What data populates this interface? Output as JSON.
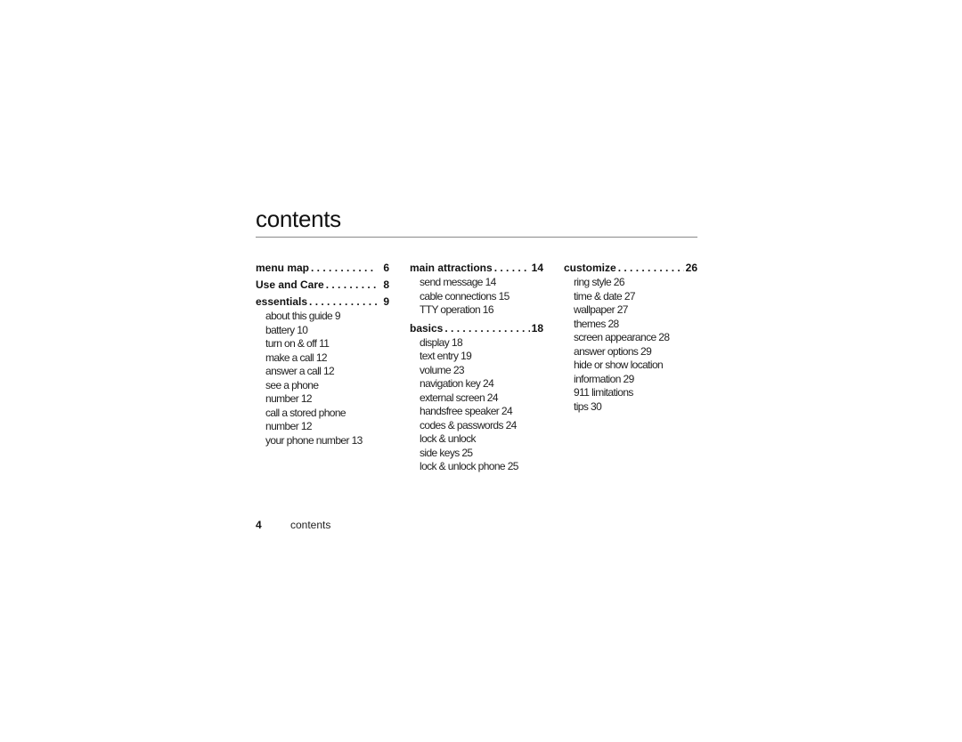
{
  "page": {
    "title": "contents",
    "footer": {
      "page_number": "4",
      "section": "contents"
    }
  },
  "columns": [
    {
      "sections": [
        {
          "label": "menu map",
          "page": "6",
          "items": []
        },
        {
          "label": "Use and Care",
          "page": "8",
          "items": []
        },
        {
          "label": "essentials",
          "page": "9",
          "items": [
            "about this guide 9",
            "battery 10",
            "turn on & off 11",
            "make a call 12",
            "answer a call 12",
            "see a phone",
            "number 12",
            "call a stored phone",
            "number 12",
            "your phone number 13"
          ]
        }
      ]
    },
    {
      "sections": [
        {
          "label": "main attractions",
          "page": "14",
          "items": [
            "send message 14",
            "cable connections 15",
            "TTY operation 16"
          ]
        },
        {
          "label": "basics",
          "page": "18",
          "items": [
            "display 18",
            "text entry 19",
            "volume 23",
            "navigation key 24",
            "external screen 24",
            "handsfree speaker 24",
            "codes & passwords 24",
            "lock & unlock",
            "side keys 25",
            "lock & unlock phone 25"
          ]
        }
      ]
    },
    {
      "sections": [
        {
          "label": "customize",
          "page": "26",
          "items": [
            "ring style 26",
            "time & date 27",
            "wallpaper 27",
            "themes 28",
            "screen appearance 28",
            "answer options 29",
            "hide or show location",
            "information 29",
            "911 limitations",
            "tips 30"
          ]
        }
      ]
    }
  ]
}
